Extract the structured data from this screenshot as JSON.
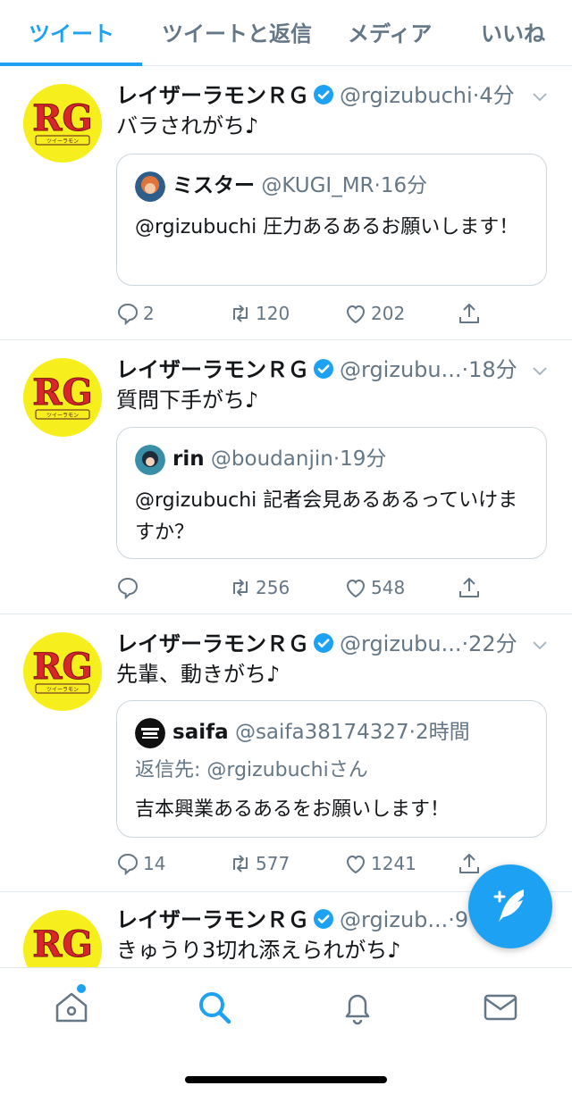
{
  "tabs": [
    {
      "label": "ツイート"
    },
    {
      "label": "ツイートと返信"
    },
    {
      "label": "メディア"
    },
    {
      "label": "いいね"
    }
  ],
  "tweets": [
    {
      "name": "レイザーラモンＲＧ",
      "handle": "@rgizubuchi",
      "time": "4分",
      "text": "バラされがち♪",
      "quote": {
        "name": "ミスター",
        "handle": "@KUGI_MR",
        "time": "16分",
        "text": "@rgizubuchi 圧力あるあるお願いします！"
      },
      "replies": "2",
      "retweets": "120",
      "likes": "202"
    },
    {
      "name": "レイザーラモンＲＧ",
      "handle": "@rgizubu...",
      "time": "18分",
      "text": "質問下手がち♪",
      "quote": {
        "name": "rin",
        "handle": "@boudanjin",
        "time": "19分",
        "text": "@rgizubuchi 記者会見あるあるっていけますか？"
      },
      "replies": "",
      "retweets": "256",
      "likes": "548"
    },
    {
      "name": "レイザーラモンＲＧ",
      "handle": "@rgizubu...",
      "time": "22分",
      "text": "先輩、動きがち♪",
      "quote": {
        "name": "saifa",
        "handle": "@saifa38174327",
        "time": "2時間",
        "reply_to": "返信先: @rgizubuchiさん",
        "text": "吉本興業あるあるをお願いします！"
      },
      "replies": "14",
      "retweets": "577",
      "likes": "1241"
    },
    {
      "name": "レイザーラモンＲＧ",
      "handle": "@rgizub...",
      "time": "9",
      "text": "きゅうり3切れ添えられがち♪"
    }
  ],
  "avatar_text": "RG",
  "avatar_subtext": "ツイーラモン",
  "dot": "·",
  "icons": {
    "verified": "verified-badge-icon",
    "reply": "reply-icon",
    "retweet": "retweet-icon",
    "like": "heart-icon",
    "share": "share-icon",
    "compose": "compose-feather-icon",
    "home": "home-icon",
    "search": "search-icon",
    "notifications": "bell-icon",
    "messages": "mail-icon"
  },
  "colors": {
    "accent": "#1da1f2",
    "text_secondary": "#657786",
    "avatar_bg": "#f7ef1d",
    "avatar_letters": "#d8262b"
  }
}
